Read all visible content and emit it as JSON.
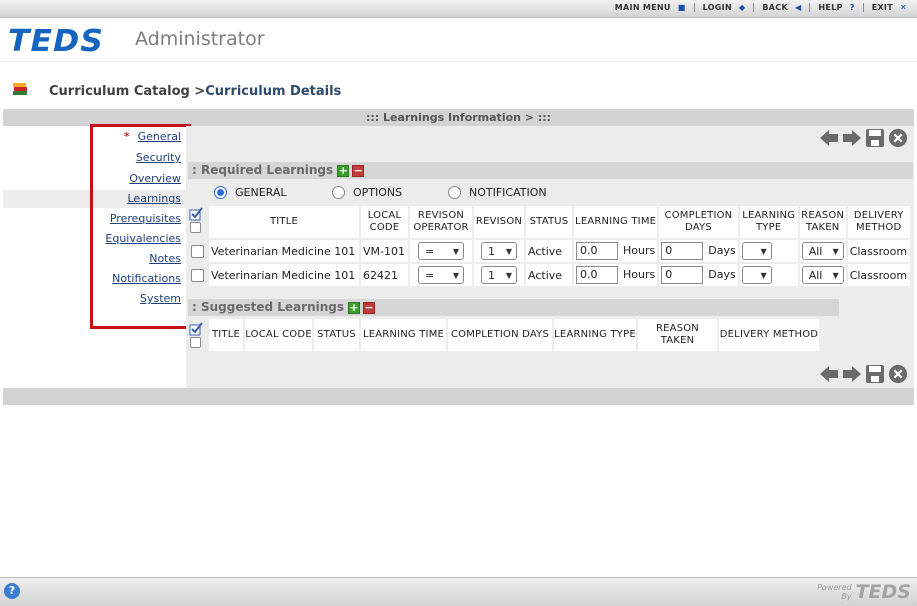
{
  "topnav": {
    "main_menu": "MAIN MENU",
    "login": "LOGIN",
    "back": "BACK",
    "help": "HELP",
    "exit": "EXIT"
  },
  "header": {
    "logo": "TEDS",
    "subtitle": "Administrator"
  },
  "breadcrumb": {
    "parent": "Curriculum Catalog >",
    "current": "Curriculum Details"
  },
  "section_title": "::: Learnings Information >  :::",
  "leftnav": {
    "required_marker": "*",
    "items": [
      "General",
      "Security",
      "Overview",
      "Learnings",
      "Prerequisites",
      "Equivalencies",
      "Notes",
      "Notifications",
      "System"
    ]
  },
  "required": {
    "title": ": Required Learnings",
    "radios": [
      "GENERAL",
      "OPTIONS",
      "NOTIFICATION"
    ],
    "selected_radio": "GENERAL",
    "headers": [
      "TITLE",
      "LOCAL CODE",
      "REVISON OPERATOR",
      "REVISON",
      "STATUS",
      "LEARNING TIME",
      "COMPLETION DAYS",
      "LEARNING TYPE",
      "REASON TAKEN",
      "DELIVERY METHOD"
    ],
    "rows": [
      {
        "title": "Veterinarian Medicine 101",
        "code": "VM-101",
        "operator": "=",
        "revision": "1",
        "status": "Active",
        "time": "0.0",
        "time_unit": "Hours",
        "days": "0",
        "days_unit": "Days",
        "type": "",
        "reason": "All",
        "delivery": "Classroom"
      },
      {
        "title": "Veterinarian Medicine 101",
        "code": "62421",
        "operator": "=",
        "revision": "1",
        "status": "Active",
        "time": "0.0",
        "time_unit": "Hours",
        "days": "0",
        "days_unit": "Days",
        "type": "",
        "reason": "All",
        "delivery": "Classroom"
      }
    ]
  },
  "suggested": {
    "title": ": Suggested Learnings",
    "headers": [
      "TITLE",
      "LOCAL CODE",
      "STATUS",
      "LEARNING TIME",
      "COMPLETION DAYS",
      "LEARNING TYPE",
      "REASON TAKEN",
      "DELIVERY METHOD"
    ]
  },
  "footer": {
    "help": "?",
    "powered_line1": "Powered",
    "powered_line2": "By",
    "powered_logo": "TEDS"
  },
  "colors": {
    "brand": "#1565c0",
    "highlight_box": "#c8101a",
    "add": "#3c9d2c",
    "remove": "#c23b3b"
  }
}
